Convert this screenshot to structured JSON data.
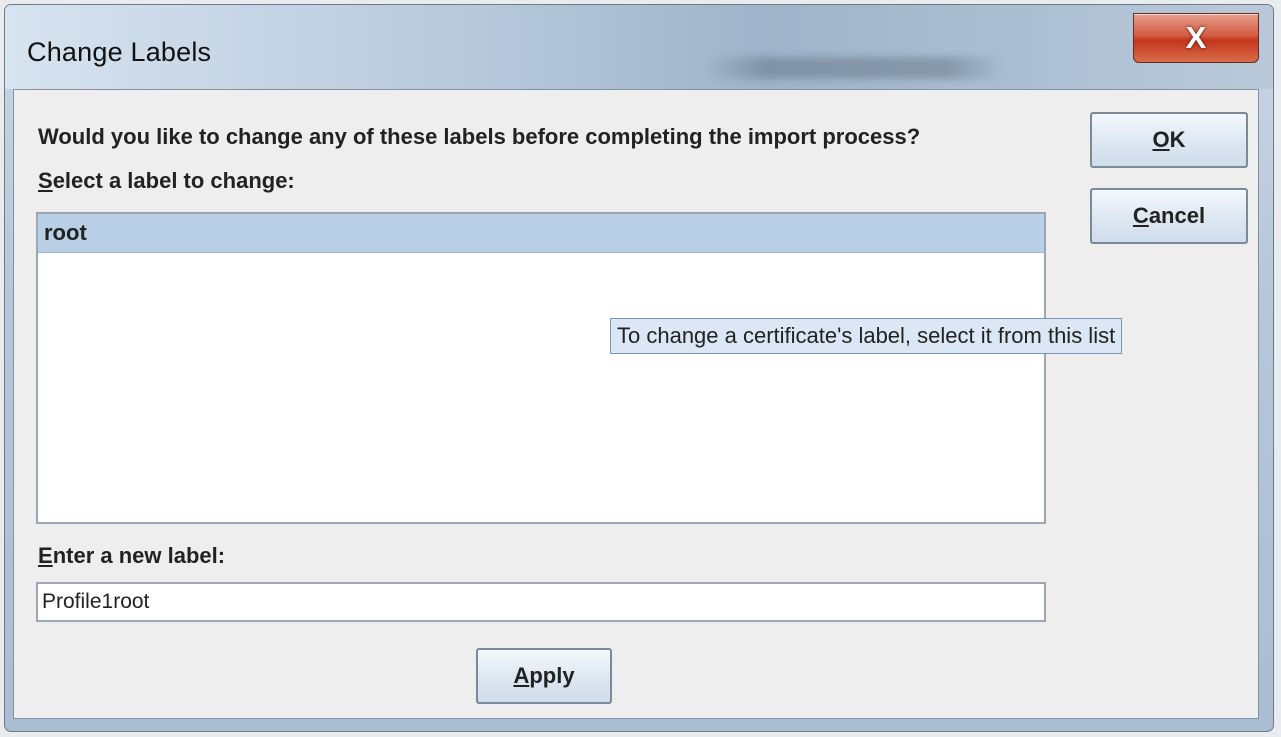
{
  "dialog": {
    "title": "Change Labels",
    "close_symbol": "X",
    "prompt": "Would you like to change any of these labels before completing the import process?",
    "select_label_mnemonic": "S",
    "select_label_rest": "elect a label to change:",
    "labels_list": [
      {
        "text": "root",
        "selected": true
      }
    ],
    "tooltip": "To change a certificate's label, select it from this list",
    "new_label_mnemonic": "E",
    "new_label_rest": "nter a new label:",
    "new_label_value": "Profile1root",
    "buttons": {
      "ok_mnemonic": "O",
      "ok_rest": "K",
      "cancel_mnemonic": "C",
      "cancel_rest": "ancel",
      "apply_mnemonic": "A",
      "apply_rest": "pply"
    }
  }
}
